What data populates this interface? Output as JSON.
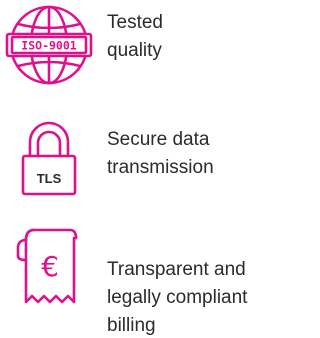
{
  "colors": {
    "accent": "#e0108c",
    "text": "#2b2b2b",
    "background": "#ffffff"
  },
  "features": [
    {
      "icon": "globe-certificate-icon",
      "icon_text": "ISO-9001",
      "lines": [
        "Tested",
        "quality"
      ]
    },
    {
      "icon": "padlock-icon",
      "icon_text": "TLS",
      "lines": [
        "Secure data",
        "transmission"
      ]
    },
    {
      "icon": "euro-receipt-icon",
      "icon_text": "€",
      "lines": [
        "Transparent and",
        "legally compliant",
        "billing"
      ]
    }
  ]
}
